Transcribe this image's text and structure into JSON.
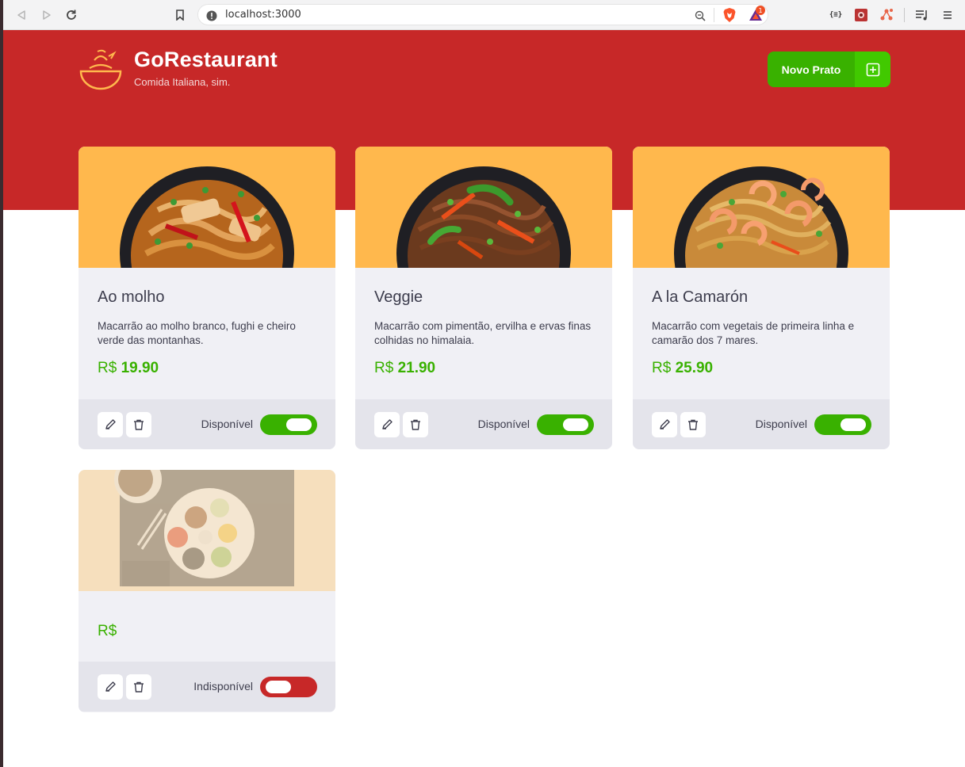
{
  "browser": {
    "url": "localhost:3000",
    "notification_count": "1"
  },
  "header": {
    "brand": "GoRestaurant",
    "tagline": "Comida Italiana, sim.",
    "new_dish_label": "Novo Prato"
  },
  "colors": {
    "brand_red": "#c72828",
    "accent_green": "#39b100",
    "card_image_bg": "#ffb84d"
  },
  "foods": [
    {
      "name": "Ao molho",
      "description": "Macarrão ao molho branco, fughi e cheiro verde das montanhas.",
      "price_prefix": "R$",
      "price": "19.90",
      "available": true,
      "status_label": "Disponível"
    },
    {
      "name": "Veggie",
      "description": "Macarrão com pimentão, ervilha e ervas finas colhidas no himalaia.",
      "price_prefix": "R$",
      "price": "21.90",
      "available": true,
      "status_label": "Disponível"
    },
    {
      "name": "A la Camarón",
      "description": "Macarrão com vegetais de primeira linha e camarão dos 7 mares.",
      "price_prefix": "R$",
      "price": "25.90",
      "available": true,
      "status_label": "Disponível"
    },
    {
      "name": "",
      "description": "",
      "price_prefix": "R$",
      "price": "",
      "available": false,
      "status_label": "Indisponível"
    }
  ]
}
